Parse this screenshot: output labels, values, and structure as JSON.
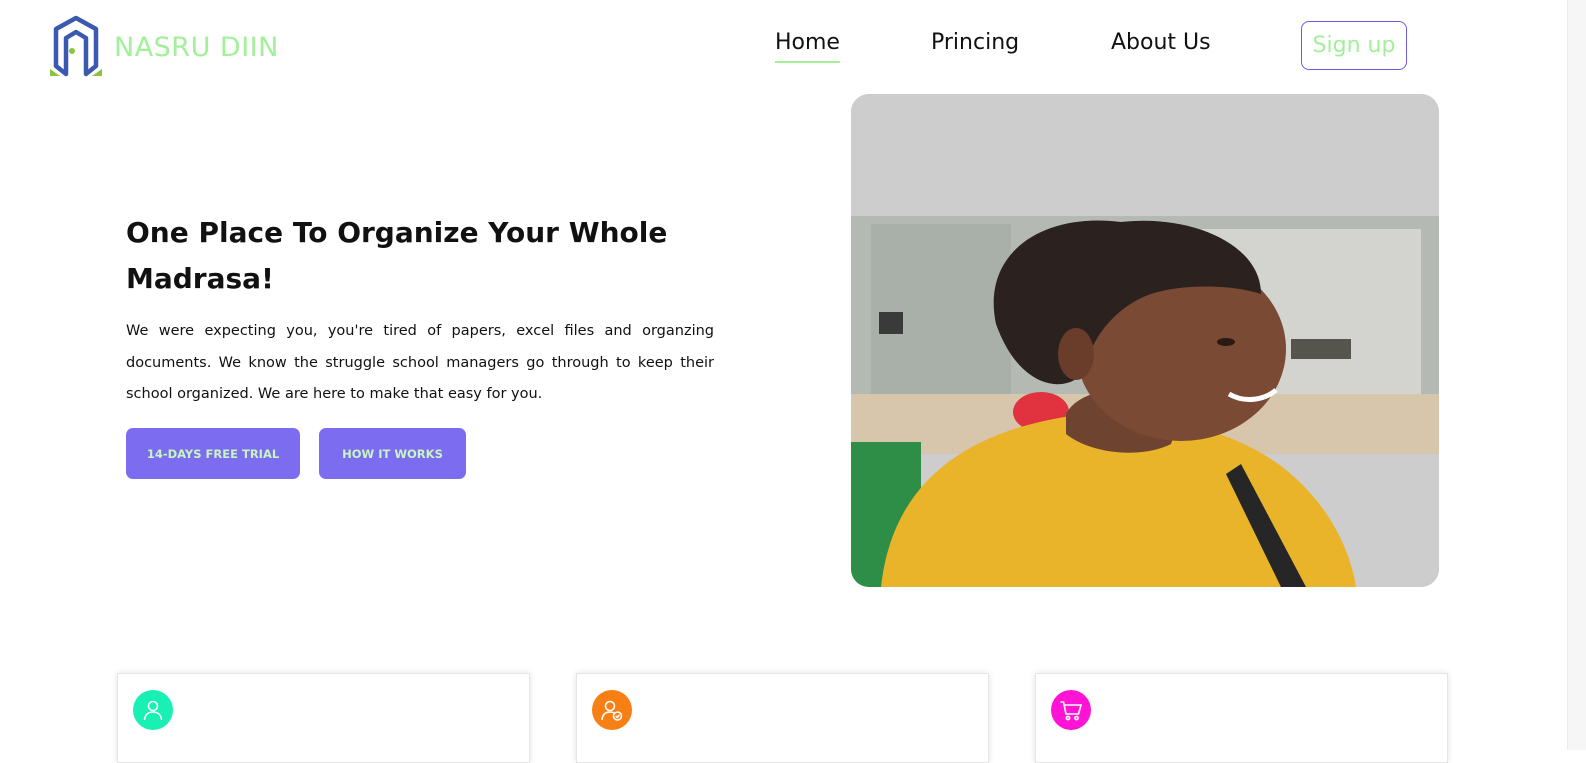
{
  "brand": {
    "name": "NASRU DIIN",
    "color": "#a3f09a",
    "logo_icon": "hexagon-logo-icon"
  },
  "nav": {
    "items": [
      {
        "label": "Home",
        "active": true
      },
      {
        "label": "Princing",
        "active": false
      },
      {
        "label": "About Us",
        "active": false
      }
    ],
    "signup_label": "Sign up"
  },
  "hero": {
    "title": "One Place To Organize Your Whole Madrasa!",
    "description": "We were expecting you, you're tired of papers, excel files and organzing documents. We know the struggle school managers go through to keep their school organized. We are here to make that easy for you.",
    "cta_primary": "14-DAYS FREE TRIAL",
    "cta_secondary": "HOW IT WORKS",
    "image_icon": "smiling-child-photo"
  },
  "features": [
    {
      "icon": "user-icon",
      "color": "#19f0b4"
    },
    {
      "icon": "user-check-icon",
      "color": "#f77f14"
    },
    {
      "icon": "cart-icon",
      "color": "#ff14d5"
    }
  ],
  "colors": {
    "accent": "#7b6cf0",
    "button_text": "#c9f5c2",
    "nav_underline": "#a3f09a"
  }
}
